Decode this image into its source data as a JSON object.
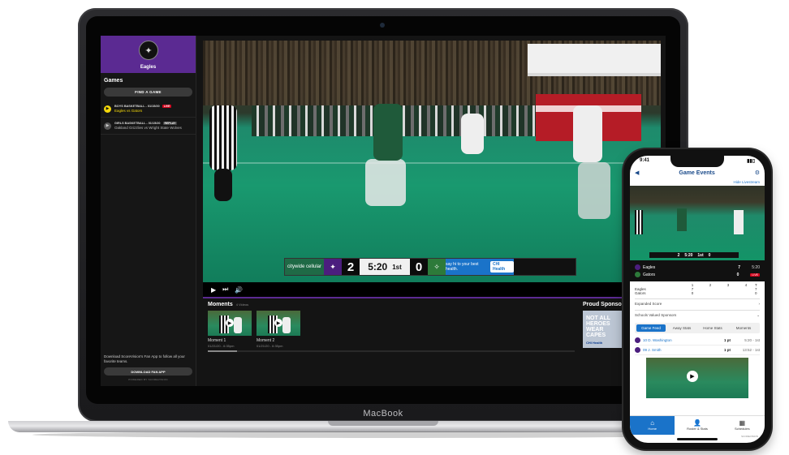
{
  "laptop": {
    "brand": "MacBook",
    "sidebar": {
      "team_name": "Eagles",
      "games_title": "Games",
      "find_game": "FIND A GAME",
      "games": [
        {
          "meta": "BOYS BASKETBALL - 01/15/20",
          "title": "Eagles vs Gators",
          "badge": "LIVE",
          "active": true
        },
        {
          "meta": "GIRLS BASKETBALL - 01/15/20",
          "title": "Oakland Grizzlies vs Wright State Wolves",
          "badge": "REPLAY",
          "active": false
        }
      ],
      "download_text": "Download ScoreVision's Fan App to follow all your favorite teams.",
      "download_button": "DOWNLOAD FAN APP",
      "powered_by": "POWERED BY SCOREVISION"
    },
    "scorebug": {
      "sponsor": "citywide cellular",
      "home_score": "2",
      "clock": "5:20",
      "period": "1st",
      "away_score": "0",
      "ad_text": "say hi to your best health.",
      "ad_brand": "CHI Health"
    },
    "moments": {
      "title": "Moments",
      "count": "4 Videos",
      "items": [
        {
          "name": "Moment 1",
          "date": "01/21/20 - 6:35pm"
        },
        {
          "name": "Moment 2",
          "date": "01/21/20 - 6:35pm"
        }
      ]
    },
    "sponsors": {
      "title": "Proud Sponsors",
      "card_text": "NOT ALL HEROES WEAR CAPES",
      "card_brand": "CHI Health"
    }
  },
  "phone": {
    "time": "9:41",
    "header_title": "Game Events",
    "hide_livestream": "Hide Livestream",
    "video_score": {
      "home": "2",
      "clock": "5:20",
      "period": "1st",
      "away": "0"
    },
    "score": {
      "home_team": "Eagles",
      "home_score": "7",
      "clock": "5:20",
      "away_team": "Gators",
      "away_score": "0",
      "live": "LIVE"
    },
    "table": {
      "periods": [
        "1",
        "2",
        "3",
        "4",
        "T"
      ],
      "rows": [
        {
          "team": "Eagles",
          "q": [
            "7",
            "",
            "",
            ""
          ],
          "t": "7"
        },
        {
          "team": "Gators",
          "q": [
            "0",
            "",
            "",
            ""
          ],
          "t": "0"
        }
      ]
    },
    "expanded_score": "Expanded Score",
    "sponsors_label": "Schools Valued Sponsors",
    "tabs": [
      "Game Feed",
      "Away Stats",
      "Home Stats",
      "Moments"
    ],
    "feed": [
      {
        "name": "10 D. Washington",
        "pts": "1 pt",
        "time": "5:20 - 1st"
      },
      {
        "name": "09 J. Smith",
        "pts": "1 pt",
        "time": "13:52 - 1st"
      }
    ],
    "nav": [
      "Home",
      "Roster & Stats",
      "Schedules"
    ],
    "powered_by": "SCOREVISION"
  }
}
